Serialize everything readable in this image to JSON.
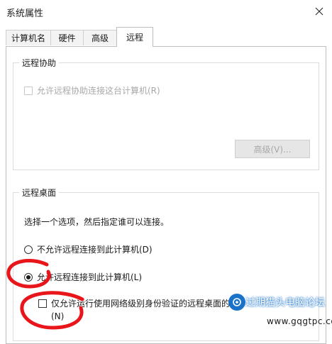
{
  "window": {
    "title": "系统属性"
  },
  "tabs": [
    {
      "label": "计算机名",
      "active": false
    },
    {
      "label": "硬件",
      "active": false
    },
    {
      "label": "高级",
      "active": false
    },
    {
      "label": "远程",
      "active": true
    }
  ],
  "remote_assistance": {
    "title": "远程协助",
    "allow_label": "允许远程协助连接这台计算机(R)",
    "allow_checked": false,
    "allow_enabled": false,
    "advanced_button": "高级(V)..."
  },
  "remote_desktop": {
    "title": "远程桌面",
    "instruction": "选择一个选项，然后指定谁可以连接。",
    "options": [
      {
        "label": "不允许远程连接到此计算机(D)",
        "checked": false
      },
      {
        "label": "允许远程连接到此计算机(L)",
        "checked": true
      }
    ],
    "nla_label": "仅允许运行使用网络级别身份验证的远程桌面的计",
    "nla_label_cont": "(N)",
    "nla_checked": false
  },
  "watermark": {
    "text": "过期猫头电脑论坛",
    "url": "www.gqgtpc.com"
  },
  "colors": {
    "annotation_red": "#e8161b",
    "watermark_blue": "#1a73c8"
  }
}
